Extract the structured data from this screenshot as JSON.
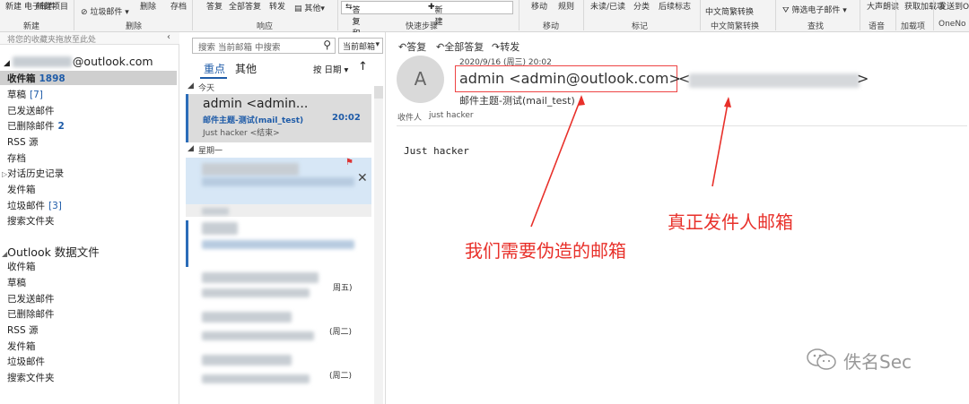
{
  "ribbon": {
    "items": [
      {
        "label": "新建\n电子邮件"
      },
      {
        "label": "新建项目"
      },
      {
        "label": "垃圾邮件"
      },
      {
        "label": "删除"
      },
      {
        "label": "存档"
      },
      {
        "label": "答复"
      },
      {
        "label": "全部答复"
      },
      {
        "label": "转发"
      },
      {
        "label": "其他"
      },
      {
        "label": "移动"
      },
      {
        "label": "规则"
      },
      {
        "label": "未读/已读"
      },
      {
        "label": "分类"
      },
      {
        "label": "后续标志"
      },
      {
        "label": "中文简繁转换"
      },
      {
        "label": "筛选电子邮件"
      },
      {
        "label": "大声朗读"
      },
      {
        "label": "获取加载项"
      },
      {
        "label": "发送到OneNote"
      }
    ],
    "groups": [
      "新建",
      "删除",
      "响应",
      "快速步骤",
      "移动",
      "标记",
      "中文简繁转换",
      "查找",
      "语音",
      "加载项",
      "OneNo"
    ],
    "quick_steps": {
      "left": "答复和删除",
      "right": "新建"
    }
  },
  "folders": {
    "collapse_hint": "将您的收藏夹拖放至此处",
    "account": "@outlook.com",
    "items": [
      {
        "label": "收件箱",
        "count": "1898",
        "selected": true
      },
      {
        "label": "草稿",
        "count": "[7]"
      },
      {
        "label": "已发送邮件",
        "count": ""
      },
      {
        "label": "已删除邮件",
        "count": "2"
      },
      {
        "label": "RSS 源",
        "count": ""
      },
      {
        "label": "存档",
        "count": ""
      },
      {
        "label": "对话历史记录",
        "count": ""
      },
      {
        "label": "发件箱",
        "count": ""
      },
      {
        "label": "垃圾邮件",
        "count": "[3]"
      },
      {
        "label": "搜索文件夹",
        "count": ""
      }
    ],
    "datafile": "Outlook 数据文件",
    "datafile_items": [
      "收件箱",
      "草稿",
      "已发送邮件",
      "已删除邮件",
      "RSS 源",
      "发件箱",
      "垃圾邮件",
      "搜索文件夹"
    ]
  },
  "list": {
    "search_placeholder": "搜索 当前邮箱 中搜索",
    "scope": "当前邮箱",
    "tab_focused": "重点",
    "tab_other": "其他",
    "sort": "按 日期",
    "group_today": "今天",
    "group_monday": "星期一",
    "msg1": {
      "from": "admin <admin...",
      "subject": "邮件主题-测试(mail_test)",
      "time": "20:02",
      "preview": "Just hacker <结束>"
    },
    "days": [
      "周五)",
      "(周二)",
      "(周二)"
    ]
  },
  "reading": {
    "actions": [
      "答复",
      "全部答复",
      "转发"
    ],
    "date": "2020/9/16 (周三) 20:02",
    "avatar": "A",
    "sender": "admin <admin@outlook.com>",
    "real_sender_open": "<",
    "real_sender_close": ">",
    "subject": "邮件主题-测试(mail_test)",
    "to_label": "收件人",
    "to": "just hacker",
    "body": "Just hacker"
  },
  "annotations": {
    "fake": "我们需要伪造的邮箱",
    "real": "真正发件人邮箱",
    "color": "#e8302a"
  },
  "watermark": "佚名Sec"
}
